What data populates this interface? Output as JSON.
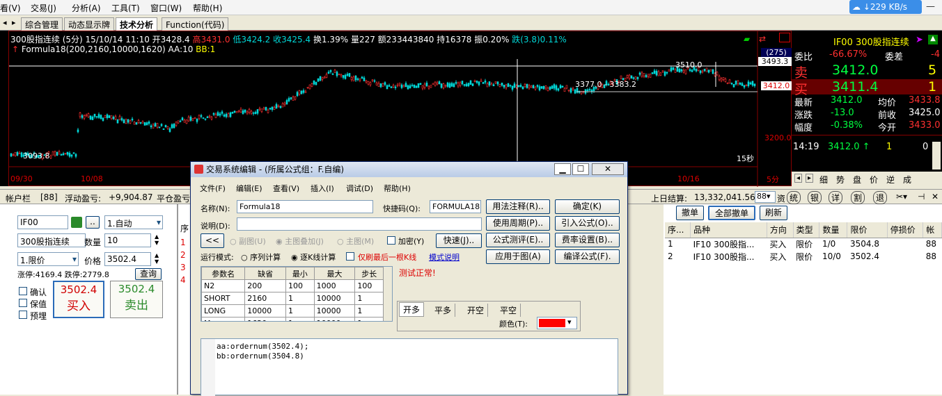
{
  "menubar": {
    "items": [
      "看(V)",
      "交易(J)",
      "分析(A)",
      "工具(T)",
      "窗口(W)",
      "帮助(H)"
    ],
    "speed": "229 KB/s"
  },
  "tabs": [
    "综合管理",
    "动态显示牌",
    "技术分析",
    "Function(代码)"
  ],
  "chart": {
    "info": {
      "name": "300股指连续 (5分)",
      "date": "15/10/14 11:10",
      "open": "开3428.4",
      "high": "高3431.0",
      "low": "低3424.2",
      "close": "收3425.4",
      "turnover": "换1.39%",
      "vol": "量227",
      "amount": "额233443840",
      "hold": "持16378",
      "amp": "振0.20%",
      "fall": "跌(3.8)0.11%"
    },
    "formula": "Formula18(200,2160,10000,1620)",
    "aa": "AA:10",
    "bb": "BB:1",
    "labels": {
      "low_mark": "3093.8",
      "high_mark": "3510.0",
      "range_mark": "3377.0 - 3383.2",
      "count": "(275)",
      "cross": "3493.3",
      "cur": "3412.0",
      "y3200": "3200.0",
      "period": "15秒",
      "period2": "5分"
    },
    "dates": [
      "09/30",
      "10/08",
      "10/16"
    ],
    "colors": {
      "up": "#ff3030",
      "down": "#00d8d8"
    }
  },
  "quote": {
    "title": "IF00  300股指连续",
    "rows": {
      "wb": [
        "委比",
        "-66.67%",
        "委差",
        "-4"
      ],
      "sell": [
        "卖",
        "3412.0",
        "5"
      ],
      "buy": [
        "买",
        "3411.4",
        "1"
      ],
      "latest": [
        "最新",
        "3412.0",
        "均价",
        "3433.8"
      ],
      "change": [
        "涨跌",
        "-13.0",
        "前收",
        "3425.0"
      ],
      "range": [
        "幅度",
        "-0.38%",
        "今开",
        "3433.0"
      ],
      "tick": [
        "14:19",
        "3412.0 ↑",
        "1",
        "0"
      ]
    },
    "tabs": [
      "细",
      "势",
      "盘",
      "价",
      "逆",
      "成"
    ]
  },
  "account": {
    "label": "帐户栏",
    "id": "[88]",
    "float": "浮动盈亏:",
    "float_val": "+9,904.87",
    "close": "平仓盈亏",
    "settle": "上日结算:",
    "settle_val": "13,332,041.56",
    "acct": "88",
    "btns": [
      "资",
      "统",
      "银",
      "详",
      "割",
      "退"
    ]
  },
  "order": {
    "code": "IF00",
    "mode": "1.自动",
    "name": "300股指连续",
    "qty_label": "数量",
    "qty": "10",
    "price_type": "1.限价",
    "price_label": "价格",
    "price": "3502.4",
    "limit": "涨停:4169.4 跌停:2779.8",
    "lookup": "查询",
    "checks": [
      "确认",
      "保值",
      "预埋"
    ],
    "buy_price": "3502.4",
    "buy_label": "买入",
    "sell_price": "3502.4",
    "sell_label": "卖出",
    "row_nums": [
      "1",
      "2",
      "3",
      "4"
    ],
    "col_head": "序"
  },
  "orders": {
    "btns": [
      "撤单",
      "全部撤单",
      "刷新"
    ],
    "headers": [
      "序...",
      "品种",
      "方向",
      "类型",
      "数量",
      "限价",
      "停损价",
      "帐"
    ],
    "rows": [
      [
        "1",
        "IF10 300股指...",
        "买入",
        "限价",
        "1/0",
        "3504.8",
        "",
        "88"
      ],
      [
        "2",
        "IF10 300股指...",
        "买入",
        "限价",
        "10/0",
        "3502.4",
        "",
        "88"
      ]
    ]
  },
  "dialog": {
    "title": "交易系统编辑 - (所属公式组：F.自编)",
    "menu": [
      "文件(F)",
      "编辑(E)",
      "查看(V)",
      "插入(I)",
      "调试(D)",
      "帮助(H)"
    ],
    "name_label": "名称(N):",
    "name_val": "Formula18",
    "code_label": "快捷码(Q):",
    "code_val": "FORMULA18",
    "desc_label": "说明(D):",
    "right_btns": [
      "用法注释(R)..",
      "确定(K)",
      "使用周期(P)..",
      "引入公式(O)..",
      "公式测评(E)..",
      "费率设置(B)..",
      "应用于图(A)",
      "编译公式(F)."
    ],
    "collapse": "<<",
    "opts": [
      "副图(U)",
      "主图叠加(J)",
      "主图(M)",
      "加密(Y)"
    ],
    "fast": "快速(J)..",
    "run_label": "运行模式:",
    "run_opts": [
      "序列计算",
      "逐K线计算"
    ],
    "last_only": "仅刷最后一根K线",
    "mode_help": "模式说明",
    "param_headers": [
      "参数名",
      "缺省",
      "最小",
      "最大",
      "步长"
    ],
    "params": [
      [
        "N2",
        "200",
        "100",
        "1000",
        "100"
      ],
      [
        "SHORT",
        "2160",
        "1",
        "10000",
        "1"
      ],
      [
        "LONG",
        "10000",
        "1",
        "10000",
        "1"
      ],
      [
        "M",
        "1620",
        "1",
        "10000",
        "1"
      ]
    ],
    "test": "测试正常!",
    "trade_tabs": [
      "开多",
      "平多",
      "开空",
      "平空"
    ],
    "color_label": "颜色(T):",
    "color_val": "#ff0000",
    "code_lines": [
      "aa:ordernum(3502.4);",
      "bb:ordernum(3504.8)"
    ]
  }
}
